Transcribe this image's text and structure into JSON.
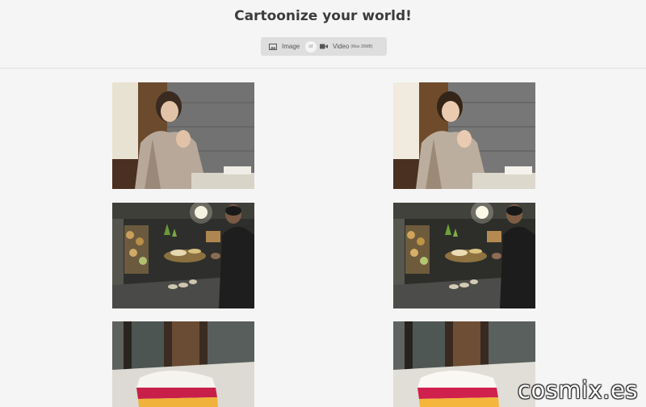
{
  "header": {
    "title": "Cartoonize your world!",
    "toggle": {
      "image_label": "Image",
      "or_label": "or",
      "video_label": "Video",
      "video_note": "(Max 30MB)",
      "image_icon": "image-icon",
      "video_icon": "video-camera-icon"
    }
  },
  "gallery": {
    "rows": [
      {
        "original": "woman-praying-photo",
        "cartoon": "woman-praying-cartoon"
      },
      {
        "original": "man-at-table-photo",
        "cartoon": "man-at-table-cartoon"
      },
      {
        "original": "cake-slice-photo",
        "cartoon": "cake-slice-cartoon"
      }
    ]
  },
  "watermark": "cosmix.es"
}
